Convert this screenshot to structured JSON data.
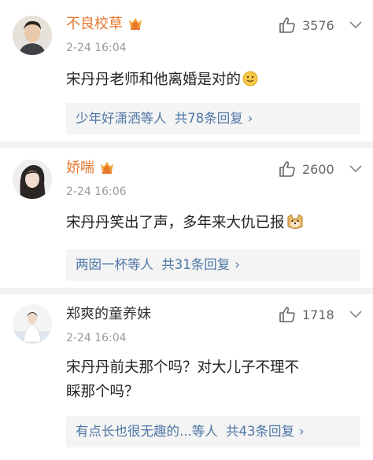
{
  "comments": [
    {
      "username": "不良校草",
      "username_color": "#e8762c",
      "time": "2-24 16:04",
      "likes": "3576",
      "text": "宋丹丹老师和他离婚是对的",
      "emoji": "smile-emoji",
      "reply_user": "少年好潇洒",
      "reply_mid": "等人",
      "reply_count_text": "共78条回复",
      "chevron": "›",
      "vip": true
    },
    {
      "username": "娇喘",
      "username_color": "#e8762c",
      "time": "2-24 16:06",
      "likes": "2600",
      "text": "宋丹丹笑出了声，多年来大仇已报",
      "emoji": "doge-emoji",
      "reply_user": "两囡一杯",
      "reply_mid": "等人",
      "reply_count_text": "共31条回复",
      "chevron": "›",
      "vip": true
    },
    {
      "username": "郑爽的童养妹",
      "username_color": "#333333",
      "time": "2-24 16:04",
      "likes": "1718",
      "text_line1": "宋丹丹前夫那个吗？对大儿子不理不",
      "text_line2": "睬那个吗？",
      "reply_user": "有点长也很无趣的...",
      "reply_mid": "等人",
      "reply_count_text": "共43条回复",
      "chevron": "›",
      "vip": false
    }
  ],
  "colors": {
    "link": "#4e76a5",
    "vip": "#e8762c",
    "time": "#9a9a9a",
    "divider": "#f2f2f2"
  }
}
